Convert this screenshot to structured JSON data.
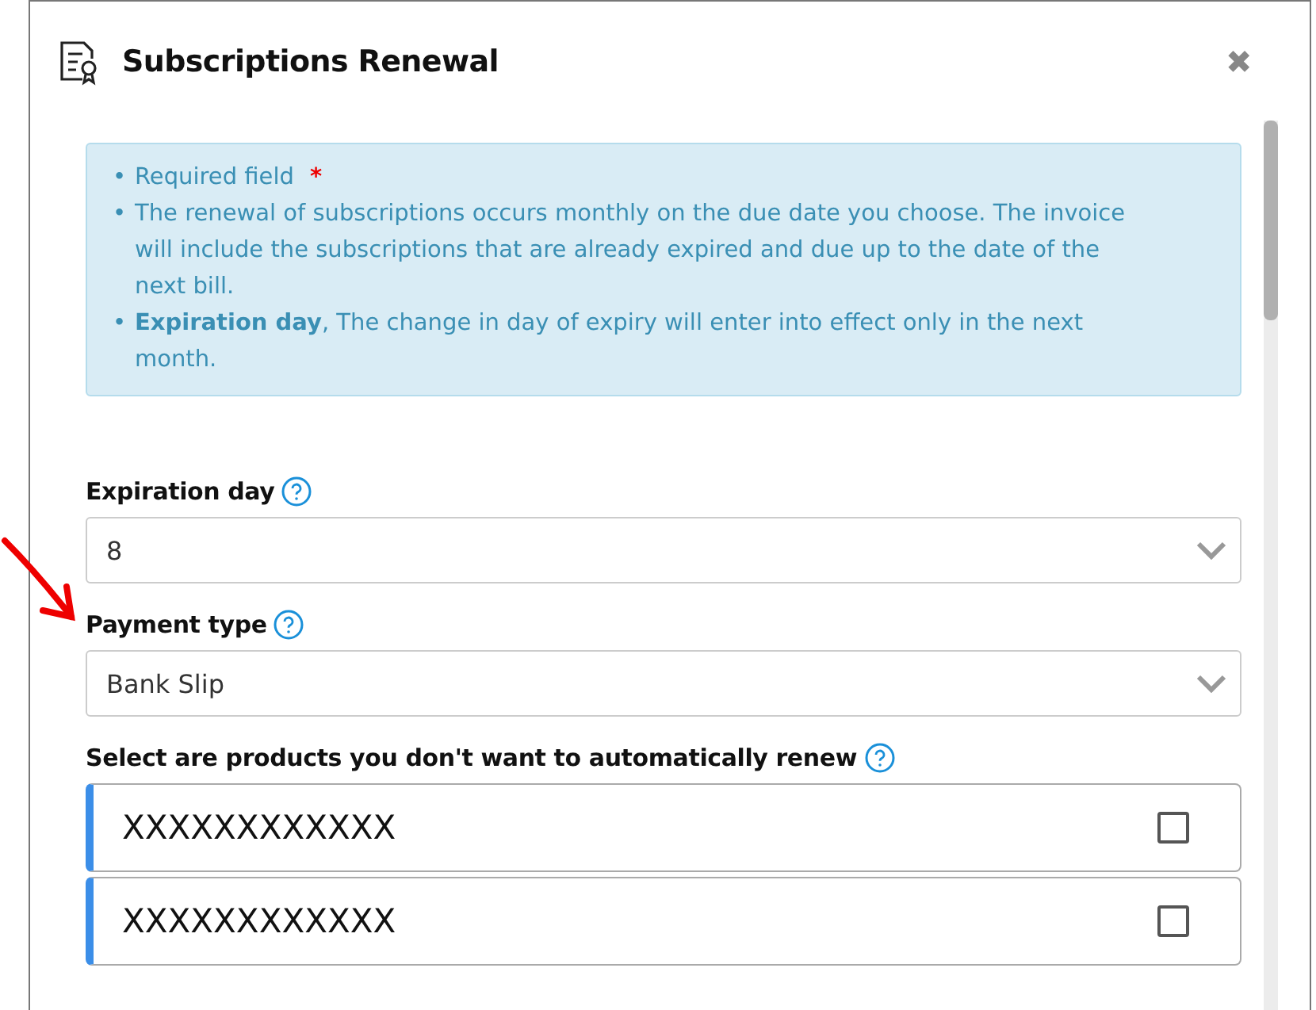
{
  "dialog": {
    "title": "Subscriptions Renewal",
    "close": "✖"
  },
  "info": {
    "items": [
      {
        "bullet": "•",
        "text": "Required field",
        "required_mark": "*"
      },
      {
        "bullet": "•",
        "text": "The renewal of subscriptions occurs monthly on the due date you choose. The invoice will include the subscriptions that are already expired and due up to the date of the next bill."
      },
      {
        "bullet": "•",
        "text": "**Expiration day**, The change in day of expiry will enter into effect only in the next month."
      }
    ]
  },
  "fields": [
    {
      "label": "Expiration day",
      "value": "8"
    },
    {
      "label": "Payment type",
      "value": "Bank Slip"
    }
  ],
  "products": {
    "label": "Select are products you don't want to automatically renew",
    "items": [
      {
        "name": "XXXXXXXXXXXX",
        "checked": false
      },
      {
        "name": "XXXXXXXXXXXX",
        "checked": false
      }
    ]
  }
}
